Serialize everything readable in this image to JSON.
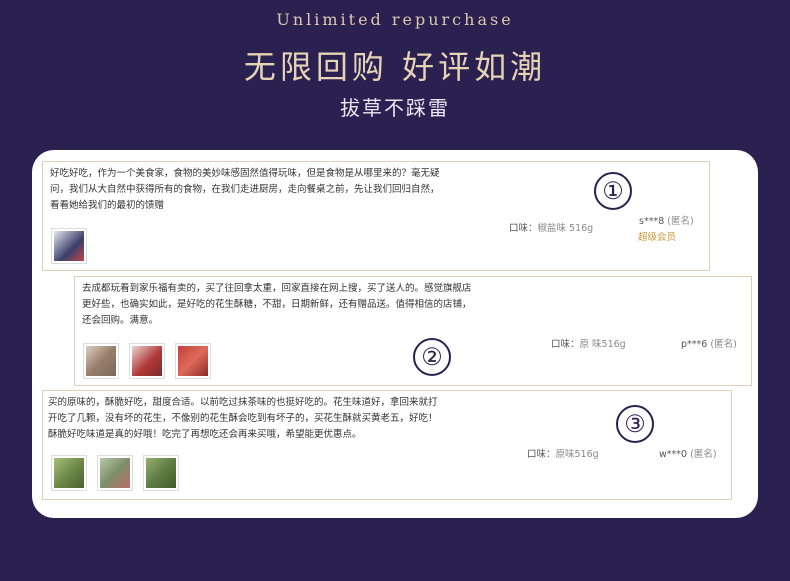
{
  "header": {
    "subtitle_en": "Unlimited repurchase",
    "title_cn": "无限回购 好评如潮",
    "slogan": "拔草不踩雷"
  },
  "reviews": [
    {
      "number": "①",
      "text_lines": [
        "好吃好吃，作为一个美食家，食物的美妙味感固然值得玩味，但是食物是从哪里来的？毫无疑",
        "问，我们从大自然中获得所有的食物，在我们走进厨房，走向餐桌之前，先让我们回归自然，",
        "看看她给我们的最初的馈赠"
      ],
      "taste_label": "口味：",
      "taste_value": "椒盐味 516g",
      "user": "s***8",
      "anonymous": "(匿名)",
      "badge": "超级会员",
      "thumbs": [
        "#3a3f6b"
      ]
    },
    {
      "number": "②",
      "text_lines": [
        "去成都玩看到家乐福有卖的，买了往回拿太重，回家直接在网上搜，买了送人的。感觉旗舰店",
        "更好些，也确实如此，是好吃的花生酥糖，不甜，日期新鲜，还有赠品送。值得相信的店铺，",
        "还会回购。满意。"
      ],
      "taste_label": "口味：",
      "taste_value": "原 味516g",
      "user": "p***6",
      "anonymous": "(匿名)",
      "badge": "",
      "thumbs": [
        "#9a7f6a",
        "#b23a3a",
        "#c2403b"
      ]
    },
    {
      "number": "③",
      "text_lines": [
        "买的原味的，酥脆好吃，甜度合适。以前吃过抹茶味的也挺好吃的。花生味道好，拿回来就打",
        "开吃了几颗，没有坏的花生，不像别的花生酥会吃到有坏子的，买花生酥就买黄老五，好吃！",
        "酥脆好吃味道是真的好哦！吃完了再想吃还会再来买哦，希望能更优惠点。"
      ],
      "taste_label": "口味：",
      "taste_value": "原味516g",
      "user": "w***0",
      "anonymous": "(匿名)",
      "badge": "",
      "thumbs": [
        "#6f8a4a",
        "#7c8f6a",
        "#5f7d45"
      ]
    }
  ]
}
